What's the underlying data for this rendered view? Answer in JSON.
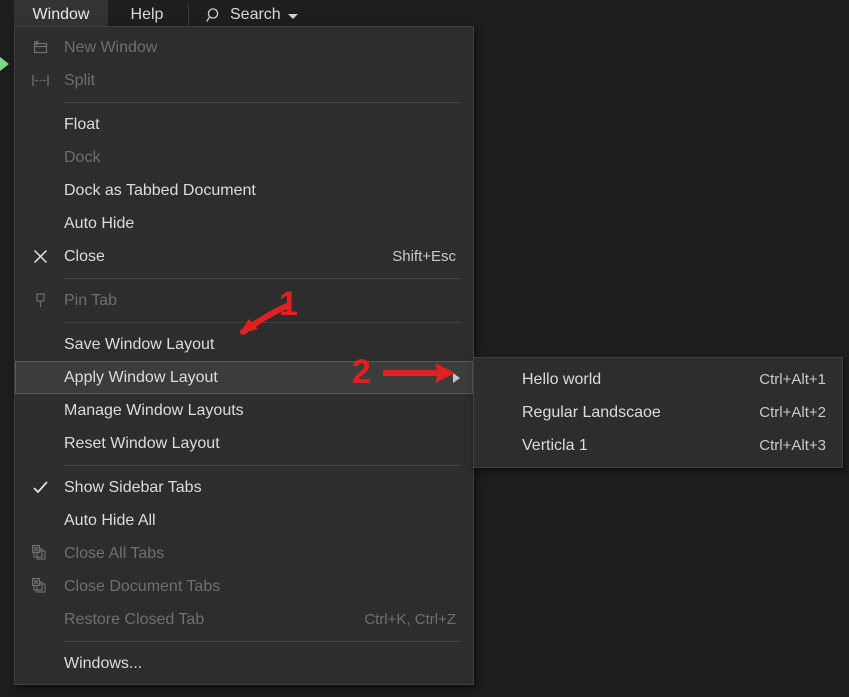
{
  "theme": {
    "background": "#1e1e1e",
    "menu_background": "#2d2d2d",
    "menu_border": "#3f3f3f",
    "highlight_background": "#3c3c3c",
    "highlight_border": "#5a5a5a",
    "text": "#dcdcdc",
    "text_disabled": "#6f6f6f",
    "annotation_red": "#e12020",
    "run_marker_green": "#7fd88f"
  },
  "menubar": {
    "tabs": [
      {
        "label": "Window",
        "active": true
      },
      {
        "label": "Help",
        "active": false
      }
    ],
    "search": {
      "label": "Search",
      "icon": "search-icon",
      "caret": "chevron-down-icon"
    }
  },
  "menu": {
    "items": [
      {
        "icon": "new-window-icon",
        "label": "New Window",
        "shortcut": "",
        "disabled": true,
        "checked": false,
        "submenu": false,
        "selected": false
      },
      {
        "icon": "split-icon",
        "label": "Split",
        "shortcut": "",
        "disabled": true,
        "checked": false,
        "submenu": false,
        "selected": false
      },
      {
        "separator": true
      },
      {
        "icon": "",
        "label": "Float",
        "shortcut": "",
        "disabled": false,
        "checked": false,
        "submenu": false,
        "selected": false
      },
      {
        "icon": "",
        "label": "Dock",
        "shortcut": "",
        "disabled": true,
        "checked": false,
        "submenu": false,
        "selected": false
      },
      {
        "icon": "",
        "label": "Dock as Tabbed Document",
        "shortcut": "",
        "disabled": false,
        "checked": false,
        "submenu": false,
        "selected": false
      },
      {
        "icon": "",
        "label": "Auto Hide",
        "shortcut": "",
        "disabled": false,
        "checked": false,
        "submenu": false,
        "selected": false
      },
      {
        "icon": "close-icon",
        "label": "Close",
        "shortcut": "Shift+Esc",
        "disabled": false,
        "checked": false,
        "submenu": false,
        "selected": false
      },
      {
        "separator": true
      },
      {
        "icon": "pin-icon",
        "label": "Pin Tab",
        "shortcut": "",
        "disabled": true,
        "checked": false,
        "submenu": false,
        "selected": false
      },
      {
        "separator": true
      },
      {
        "icon": "",
        "label": "Save Window Layout",
        "shortcut": "",
        "disabled": false,
        "checked": false,
        "submenu": false,
        "selected": false
      },
      {
        "icon": "",
        "label": "Apply Window Layout",
        "shortcut": "",
        "disabled": false,
        "checked": false,
        "submenu": true,
        "selected": true
      },
      {
        "icon": "",
        "label": "Manage Window Layouts",
        "shortcut": "",
        "disabled": false,
        "checked": false,
        "submenu": false,
        "selected": false
      },
      {
        "icon": "",
        "label": "Reset Window Layout",
        "shortcut": "",
        "disabled": false,
        "checked": false,
        "submenu": false,
        "selected": false
      },
      {
        "separator": true
      },
      {
        "icon": "check-icon",
        "label": "Show Sidebar Tabs",
        "shortcut": "",
        "disabled": false,
        "checked": true,
        "submenu": false,
        "selected": false
      },
      {
        "icon": "",
        "label": "Auto Hide All",
        "shortcut": "",
        "disabled": false,
        "checked": false,
        "submenu": false,
        "selected": false
      },
      {
        "icon": "close-all-tabs-icon",
        "label": "Close All Tabs",
        "shortcut": "",
        "disabled": true,
        "checked": false,
        "submenu": false,
        "selected": false
      },
      {
        "icon": "close-document-tabs-icon",
        "label": "Close Document Tabs",
        "shortcut": "",
        "disabled": true,
        "checked": false,
        "submenu": false,
        "selected": false
      },
      {
        "icon": "",
        "label": "Restore Closed Tab",
        "shortcut": "Ctrl+K, Ctrl+Z",
        "disabled": true,
        "checked": false,
        "submenu": false,
        "selected": false
      },
      {
        "separator": true
      },
      {
        "icon": "",
        "label": "Windows...",
        "shortcut": "",
        "disabled": false,
        "checked": false,
        "submenu": false,
        "selected": false
      }
    ]
  },
  "submenu": {
    "items": [
      {
        "label": "Hello world",
        "shortcut": "Ctrl+Alt+1"
      },
      {
        "label": "Regular Landscaoe",
        "shortcut": "Ctrl+Alt+2"
      },
      {
        "label": "Verticla 1",
        "shortcut": "Ctrl+Alt+3"
      }
    ]
  },
  "annotations": [
    {
      "number": "1",
      "target": "Save Window Layout",
      "arrow": "arrow-down-left"
    },
    {
      "number": "2",
      "target": "Apply Window Layout",
      "arrow": "arrow-right"
    }
  ]
}
